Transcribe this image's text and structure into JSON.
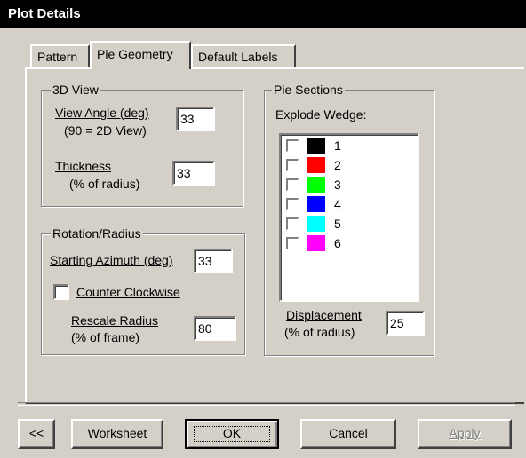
{
  "window": {
    "title": "Plot Details"
  },
  "tabs": [
    {
      "label": "Pattern"
    },
    {
      "label": "Pie Geometry",
      "active": true
    },
    {
      "label": "Default Labels"
    }
  ],
  "view3d": {
    "legend": "3D View",
    "view_angle_label": "View Angle (deg)",
    "view_angle_hint": "(90 = 2D View)",
    "view_angle_value": "33",
    "thickness_label": "Thickness",
    "thickness_hint": "(% of radius)",
    "thickness_value": "33"
  },
  "rotation": {
    "legend": "Rotation/Radius",
    "azimuth_label": "Starting Azimuth (deg)",
    "azimuth_value": "33",
    "ccw_label": "Counter Clockwise",
    "ccw_checked": false,
    "rescale_label": "Rescale Radius",
    "rescale_hint": "(% of frame)",
    "rescale_value": "80"
  },
  "pie_sections": {
    "legend": "Pie Sections",
    "explode_label": "Explode Wedge:",
    "wedges": [
      {
        "label": "1",
        "color": "#000000",
        "checked": false
      },
      {
        "label": "2",
        "color": "#ff0000",
        "checked": false
      },
      {
        "label": "3",
        "color": "#00ff00",
        "checked": false
      },
      {
        "label": "4",
        "color": "#0000ff",
        "checked": false
      },
      {
        "label": "5",
        "color": "#00ffff",
        "checked": false
      },
      {
        "label": "6",
        "color": "#ff00ff",
        "checked": false
      }
    ],
    "displacement_label": "Displacement",
    "displacement_hint": "(% of radius)",
    "displacement_value": "25"
  },
  "buttons": {
    "back": "<<",
    "worksheet": "Worksheet",
    "ok": "OK",
    "cancel": "Cancel",
    "apply": "Apply"
  }
}
